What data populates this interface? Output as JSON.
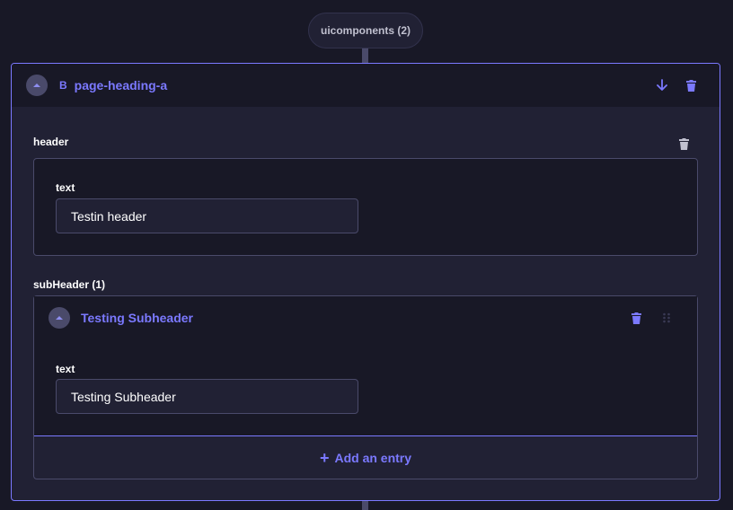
{
  "dynamic_zone": {
    "label": "uicomponents (2)"
  },
  "component": {
    "badge": "B",
    "title": "page-heading-a",
    "icons": [
      "chevron-up-icon",
      "arrow-down-icon",
      "trash-icon"
    ],
    "header": {
      "label": "header",
      "field_label": "text",
      "value": "Testin header"
    },
    "sub_header": {
      "label": "subHeader (1)",
      "entry_title": "Testing Subheader",
      "field_label": "text",
      "value": "Testing Subheader",
      "add_entry_label": "Add an entry"
    }
  },
  "colors": {
    "accent": "#7b79ff",
    "background": "#181826",
    "panel": "#212134",
    "border": "#4a4a6a"
  }
}
